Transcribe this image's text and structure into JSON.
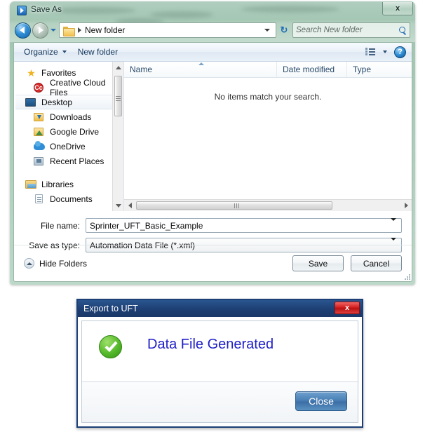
{
  "save_as_window": {
    "title": "Save As",
    "close_label": "x",
    "nav": {
      "breadcrumb": "New folder",
      "search_placeholder": "Search New folder",
      "refresh_label": "↻"
    },
    "toolbar": {
      "organize_label_pre": "Or",
      "organize_label_accel": "g",
      "organize_label_post": "anize",
      "new_folder_label": "New folder",
      "help_label": "?"
    },
    "sidebar": {
      "items": [
        {
          "label": "Favorites",
          "icon": "star-icon",
          "indent": false,
          "selected": false
        },
        {
          "label": "Creative Cloud Files",
          "icon": "creative-cloud-icon",
          "indent": true,
          "selected": false
        },
        {
          "label": "Desktop",
          "icon": "desktop-icon",
          "indent": true,
          "selected": true
        },
        {
          "label": "Downloads",
          "icon": "downloads-icon",
          "indent": true,
          "selected": false
        },
        {
          "label": "Google Drive",
          "icon": "google-drive-icon",
          "indent": true,
          "selected": false
        },
        {
          "label": "OneDrive",
          "icon": "onedrive-icon",
          "indent": true,
          "selected": false
        },
        {
          "label": "Recent Places",
          "icon": "recent-places-icon",
          "indent": true,
          "selected": false
        },
        {
          "label": "Libraries",
          "icon": "libraries-icon",
          "indent": false,
          "selected": false
        },
        {
          "label": "Documents",
          "icon": "document-icon",
          "indent": true,
          "selected": false
        }
      ]
    },
    "file_list": {
      "columns": [
        "Name",
        "Date modified",
        "Type"
      ],
      "rows": [],
      "empty_message": "No items match your search.",
      "sort_column": "Name",
      "sort_direction": "ascending"
    },
    "fields": {
      "file_name_label": "File name:",
      "file_name_value": "Sprinter_UFT_Basic_Example",
      "save_as_type_label": "Save as type:",
      "save_as_type_value": "Automation Data File (*.xml)"
    },
    "footer": {
      "hide_folders_label": "Hide Folders",
      "save_label": "Save",
      "cancel_label": "Cancel"
    }
  },
  "uft_dialog": {
    "title": "Export to UFT",
    "close_x_label": "x",
    "status_icon": "success-check-icon",
    "message": "Data File Generated",
    "close_button_label": "Close",
    "colors": {
      "title_bar": "#1d3f73",
      "close_x": "#d42020",
      "message_text": "#2020c8",
      "check_green": "#56b92b",
      "button_blue": "#4a80b6"
    }
  }
}
